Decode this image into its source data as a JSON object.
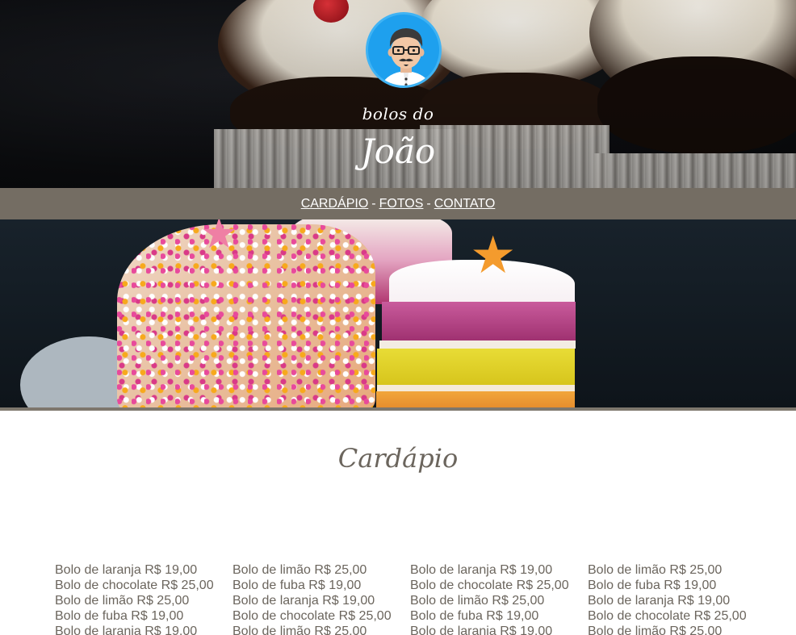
{
  "brand": {
    "line1": "bolos do",
    "line2": "João"
  },
  "nav": {
    "items": [
      {
        "label": "CARDÁPIO"
      },
      {
        "label": "FOTOS"
      },
      {
        "label": "CONTATO"
      }
    ],
    "separator": "-"
  },
  "menu": {
    "title": "Cardápio",
    "columns": [
      [
        "Bolo de laranja R$ 19,00",
        "Bolo de chocolate R$ 25,00",
        "Bolo de limão R$ 25,00",
        "Bolo de fuba R$ 19,00",
        "Bolo de laranja R$ 19,00"
      ],
      [
        "Bolo de limão R$ 25,00",
        "Bolo de fuba R$ 19,00",
        "Bolo de laranja R$ 19,00",
        "Bolo de chocolate R$ 25,00",
        "Bolo de limão R$ 25,00"
      ],
      [
        "Bolo de laranja R$ 19,00",
        "Bolo de chocolate R$ 25,00",
        "Bolo de limão R$ 25,00",
        "Bolo de fuba R$ 19,00",
        "Bolo de laranja R$ 19,00"
      ],
      [
        "Bolo de limão R$ 25,00",
        "Bolo de fuba R$ 19,00",
        "Bolo de laranja R$ 19,00",
        "Bolo de chocolate R$ 25,00",
        "Bolo de limão R$ 25,00"
      ]
    ]
  },
  "colors": {
    "nav_bg": "#746d63",
    "heading": "#6b655d",
    "text": "#6b655d",
    "logo_bg": "#1ea0ee"
  },
  "icons": {
    "logo": "chef-avatar-icon"
  }
}
